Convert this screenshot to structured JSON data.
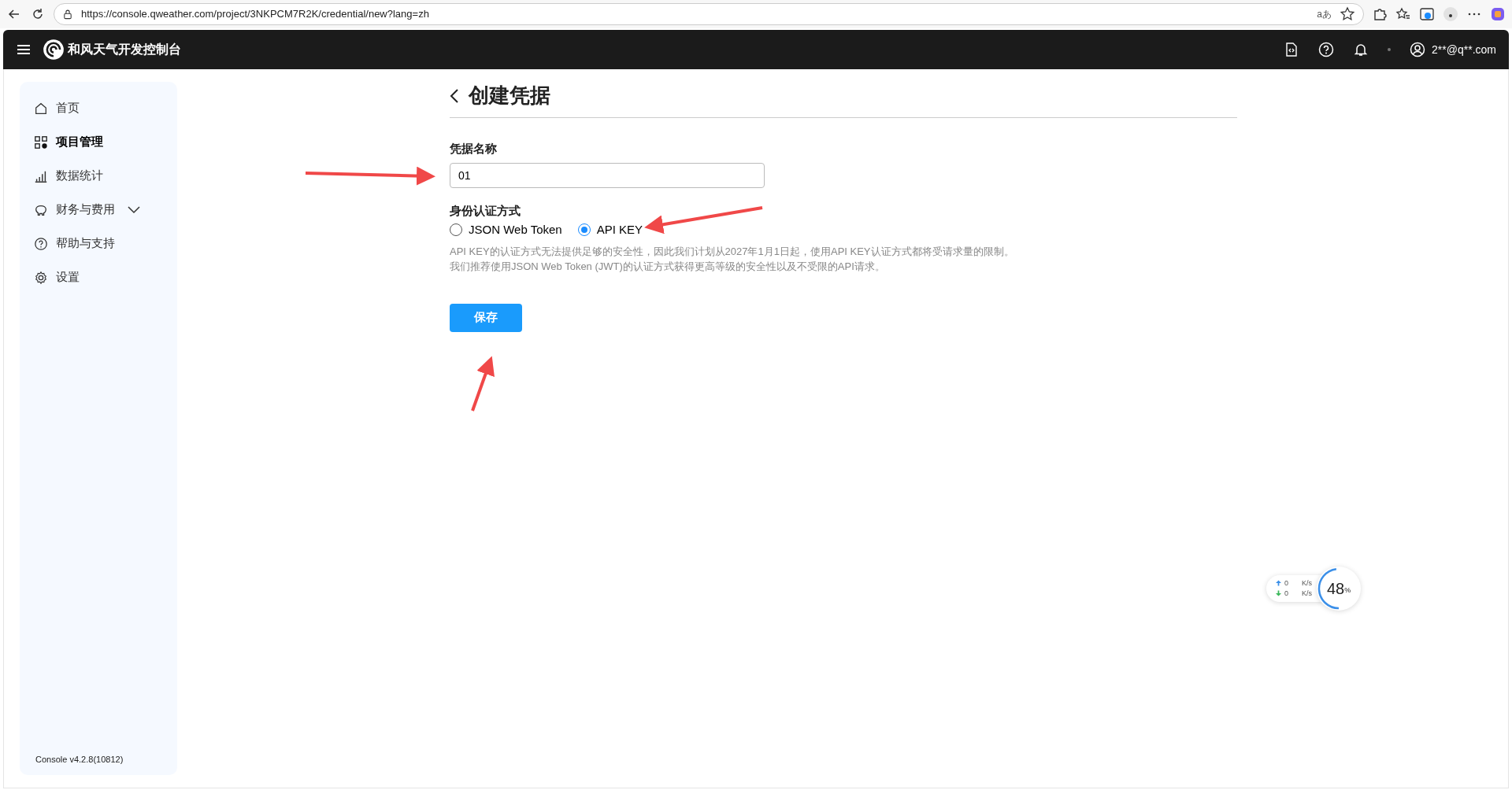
{
  "browser": {
    "url": "https://console.qweather.com/project/3NKPCM7R2K/credential/new?lang=zh",
    "read_aloud": "aあ"
  },
  "header": {
    "title": "和风天气开发控制台",
    "user": "2**@q**.com"
  },
  "sidebar": {
    "items": [
      {
        "label": "首页",
        "selected": false
      },
      {
        "label": "项目管理",
        "selected": true
      },
      {
        "label": "数据统计",
        "selected": false
      },
      {
        "label": "财务与费用",
        "selected": false,
        "expanded": false
      },
      {
        "label": "帮助与支持",
        "selected": false
      },
      {
        "label": "设置",
        "selected": false
      }
    ],
    "version": "Console v4.2.8(10812)"
  },
  "form": {
    "title": "创建凭据",
    "name_label": "凭据名称",
    "name_value": "01",
    "auth_label": "身份认证方式",
    "auth_options": [
      {
        "label": "JSON Web Token",
        "selected": false
      },
      {
        "label": "API KEY",
        "selected": true
      }
    ],
    "help_lines": [
      "API KEY的认证方式无法提供足够的安全性，因此我们计划从2027年1月1日起，使用API KEY认证方式都将受请求量的限制。",
      "我们推荐使用JSON Web Token (JWT)的认证方式获得更高等级的安全性以及不受限的API请求。"
    ],
    "save": "保存"
  },
  "net_widget": {
    "up": "0",
    "down": "0",
    "unit_up": "K/s",
    "unit_down": "K/s",
    "percent": "48",
    "percent_sign": "%",
    "level": 0.48
  }
}
